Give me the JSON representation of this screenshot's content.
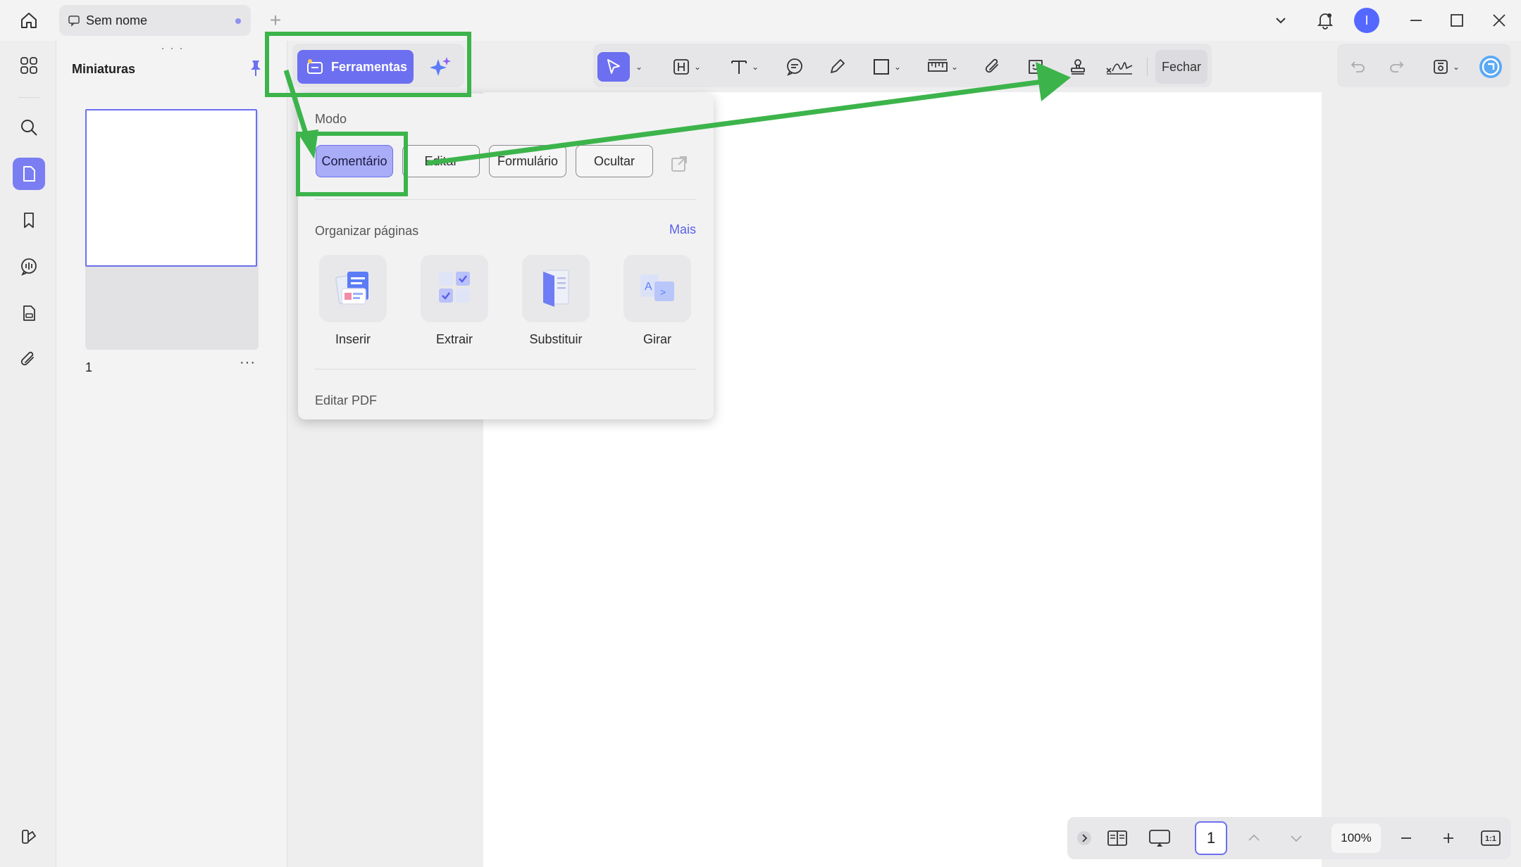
{
  "titlebar": {
    "tab_title": "Sem nome",
    "avatar_initial": "I"
  },
  "thumbnails": {
    "title": "Miniaturas",
    "page_number": "1",
    "more": "···"
  },
  "toolbar": {
    "tools_label": "Ferramentas",
    "close_label": "Fechar"
  },
  "panel": {
    "mode_heading": "Modo",
    "modes": [
      {
        "label": "Comentário",
        "active": true
      },
      {
        "label": "Editar",
        "active": false
      },
      {
        "label": "Formulário",
        "active": false
      },
      {
        "label": "Ocultar",
        "active": false
      }
    ],
    "organize_heading": "Organizar páginas",
    "more_link": "Mais",
    "organize_items": [
      {
        "label": "Inserir",
        "icon": "insert-pages-icon"
      },
      {
        "label": "Extrair",
        "icon": "extract-pages-icon"
      },
      {
        "label": "Substituir",
        "icon": "replace-pages-icon"
      },
      {
        "label": "Girar",
        "icon": "rotate-pages-icon"
      }
    ],
    "edit_pdf_heading": "Editar PDF"
  },
  "statusbar": {
    "current_page": "1",
    "zoom": "100%",
    "fit_label": "1:1"
  },
  "colors": {
    "accent": "#6c6ff0",
    "annotation_green": "#3cb44b",
    "link": "#5b5fe8"
  }
}
